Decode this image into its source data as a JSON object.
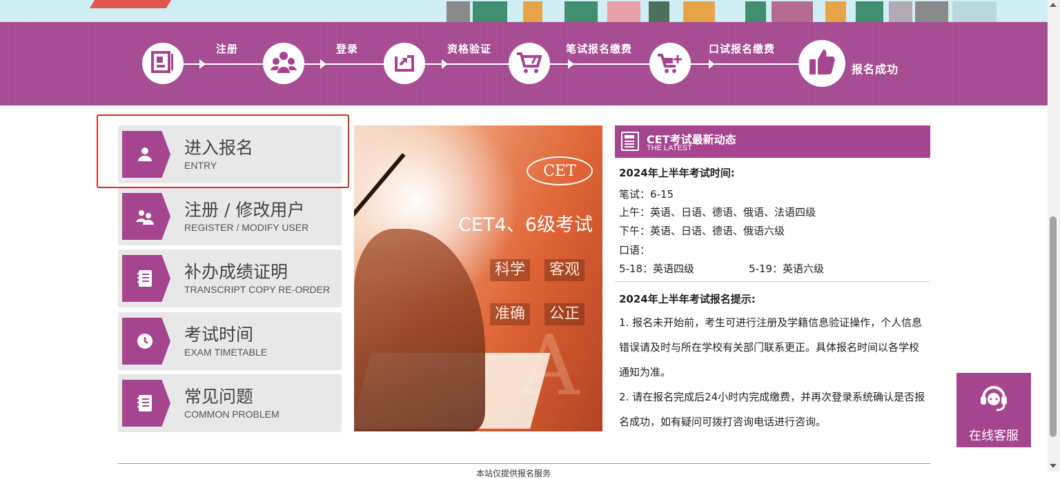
{
  "steps": [
    {
      "label": "注册",
      "icon": "register-card-icon"
    },
    {
      "label": "登录",
      "icon": "users-group-icon"
    },
    {
      "label": "资格验证",
      "icon": "verify-arrow-icon"
    },
    {
      "label": "笔试报名缴费",
      "icon": "cart-icon"
    },
    {
      "label": "口试报名缴费",
      "icon": "cart-plus-icon"
    },
    {
      "label": "报名成功",
      "icon": "thumbs-up-icon"
    }
  ],
  "menu": [
    {
      "title": "进入报名",
      "subtitle": "ENTRY",
      "icon": "user-icon"
    },
    {
      "title": "注册 / 修改用户",
      "subtitle": "REGISTER / MODIFY USER",
      "icon": "users-icon"
    },
    {
      "title": "补办成绩证明",
      "subtitle": "TRANSCRIPT COPY RE-ORDER",
      "icon": "document-icon"
    },
    {
      "title": "考试时间",
      "subtitle": "EXAM TIMETABLE",
      "icon": "clock-icon"
    },
    {
      "title": "常见问题",
      "subtitle": "COMMON PROBLEM",
      "icon": "document-icon"
    }
  ],
  "banner": {
    "logo": "CET",
    "headline": "CET4、6级考试",
    "tags": [
      "科学",
      "客观",
      "准确",
      "公正"
    ]
  },
  "news": {
    "title": "CET考试最新动态",
    "subtitle": "THE LATEST",
    "section1_title": "2024年上半年考试时间:",
    "lines": [
      "笔试：6-15",
      "上午：英语、日语、德语、俄语、法语四级",
      "下午：英语、日语、德语、俄语六级",
      "口语："
    ],
    "oral_left": "5-18：英语四级",
    "oral_right": "5-19：英语六级",
    "section2_title": "2024年上半年考试报名提示:",
    "tip1": "1. 报名未开始前，考生可进行注册及学籍信息验证操作，个人信息错误请及时与所在学校有关部门联系更正。具体报名时间以各学校通知为准。",
    "tip2": "2. 请在报名完成后24小时内完成缴费，并再次登录系统确认是否报名成功，如有疑问可拨打咨询电话进行咨询。"
  },
  "service": {
    "label": "在线客服",
    "icon": "headset-icon"
  },
  "footer": {
    "text": "本站仅提供报名服务"
  },
  "colors": {
    "brand_purple": "#a5448f",
    "highlight_red": "#e12a1f",
    "strip_blue": "#cfeff5"
  }
}
